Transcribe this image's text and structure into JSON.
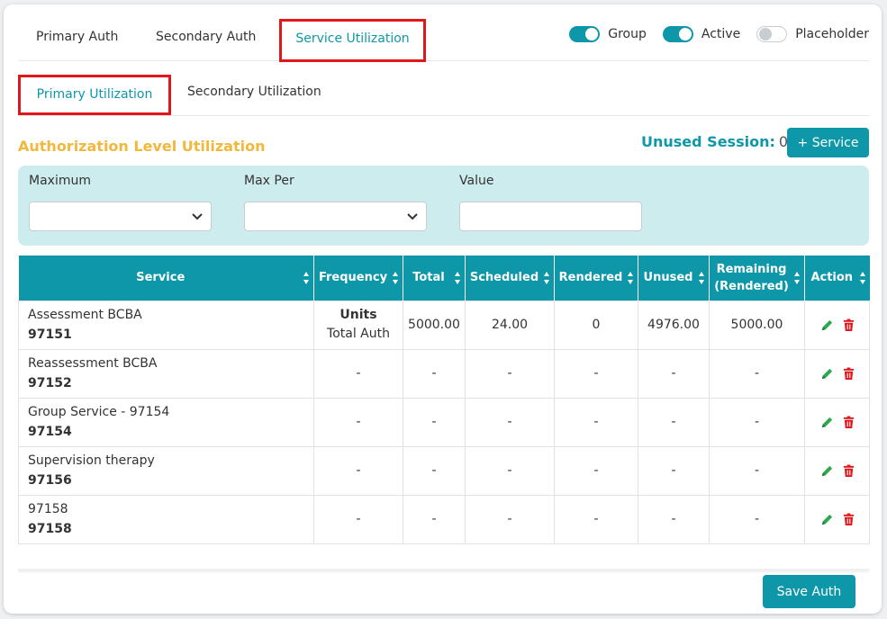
{
  "tabs": [
    {
      "label": "Primary Auth"
    },
    {
      "label": "Secondary Auth"
    },
    {
      "label": "Service Utilization"
    }
  ],
  "toggles": [
    {
      "label": "Group",
      "on": true
    },
    {
      "label": "Active",
      "on": true
    },
    {
      "label": "Placeholder",
      "on": false
    }
  ],
  "subtabs": [
    {
      "label": "Primary Utilization"
    },
    {
      "label": "Secondary Utilization"
    }
  ],
  "section_title": "Authorization Level Utilization",
  "unused_session": {
    "label": "Unused Session:",
    "count": "0"
  },
  "add_service_label": "+ Service",
  "filters": {
    "maximum_label": "Maximum",
    "max_per_label": "Max Per",
    "value_label": "Value"
  },
  "table": {
    "headers": [
      "Service",
      "Frequency",
      "Total",
      "Scheduled",
      "Rendered",
      "Unused",
      "Remaining\n(Rendered)",
      "Action"
    ],
    "rows": [
      {
        "name": "Assessment BCBA",
        "code": "97151",
        "freq_bold": "Units",
        "freq_sub": "Total Auth",
        "total": "5000.00",
        "scheduled": "24.00",
        "rendered": "0",
        "unused": "4976.00",
        "remaining": "5000.00"
      },
      {
        "name": "Reassessment BCBA",
        "code": "97152",
        "freq_bold": "",
        "freq_sub": "-",
        "total": "-",
        "scheduled": "-",
        "rendered": "-",
        "unused": "-",
        "remaining": "-"
      },
      {
        "name": "Group Service - 97154",
        "code": "97154",
        "freq_bold": "",
        "freq_sub": "-",
        "total": "-",
        "scheduled": "-",
        "rendered": "-",
        "unused": "-",
        "remaining": "-"
      },
      {
        "name": "Supervision therapy",
        "code": "97156",
        "freq_bold": "",
        "freq_sub": "-",
        "total": "-",
        "scheduled": "-",
        "rendered": "-",
        "unused": "-",
        "remaining": "-"
      },
      {
        "name": "97158",
        "code": "97158",
        "freq_bold": "",
        "freq_sub": "-",
        "total": "-",
        "scheduled": "-",
        "rendered": "-",
        "unused": "-",
        "remaining": "-"
      }
    ]
  },
  "save_label": "Save Auth",
  "colors": {
    "accent": "#0e97a8",
    "highlight": "#e0161b",
    "title": "#f2b73b",
    "edit": "#2fa84f",
    "delete": "#e0161b"
  }
}
